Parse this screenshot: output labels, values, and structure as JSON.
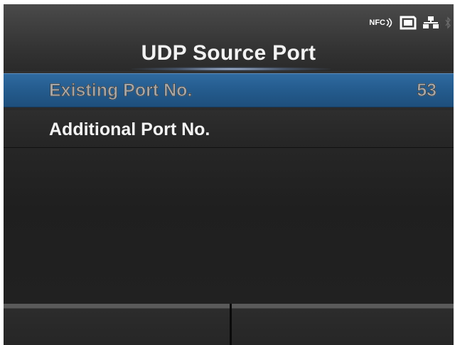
{
  "header": {
    "title": "UDP Source Port",
    "status_icons": [
      {
        "name": "nfc-icon",
        "text": "NFC"
      },
      {
        "name": "sd-card-icon"
      },
      {
        "name": "network-icon"
      },
      {
        "name": "bluetooth-icon"
      }
    ]
  },
  "menu": {
    "items": [
      {
        "label": "Existing Port No.",
        "value": "53",
        "selected": true
      },
      {
        "label": "Additional Port No.",
        "value": "",
        "selected": false
      }
    ]
  },
  "softkeys": [
    {
      "label": ""
    },
    {
      "label": ""
    }
  ],
  "colors": {
    "selected_bg": "#245b8d",
    "screen_bg": "#2b2b2b",
    "text": "#ffffff"
  }
}
